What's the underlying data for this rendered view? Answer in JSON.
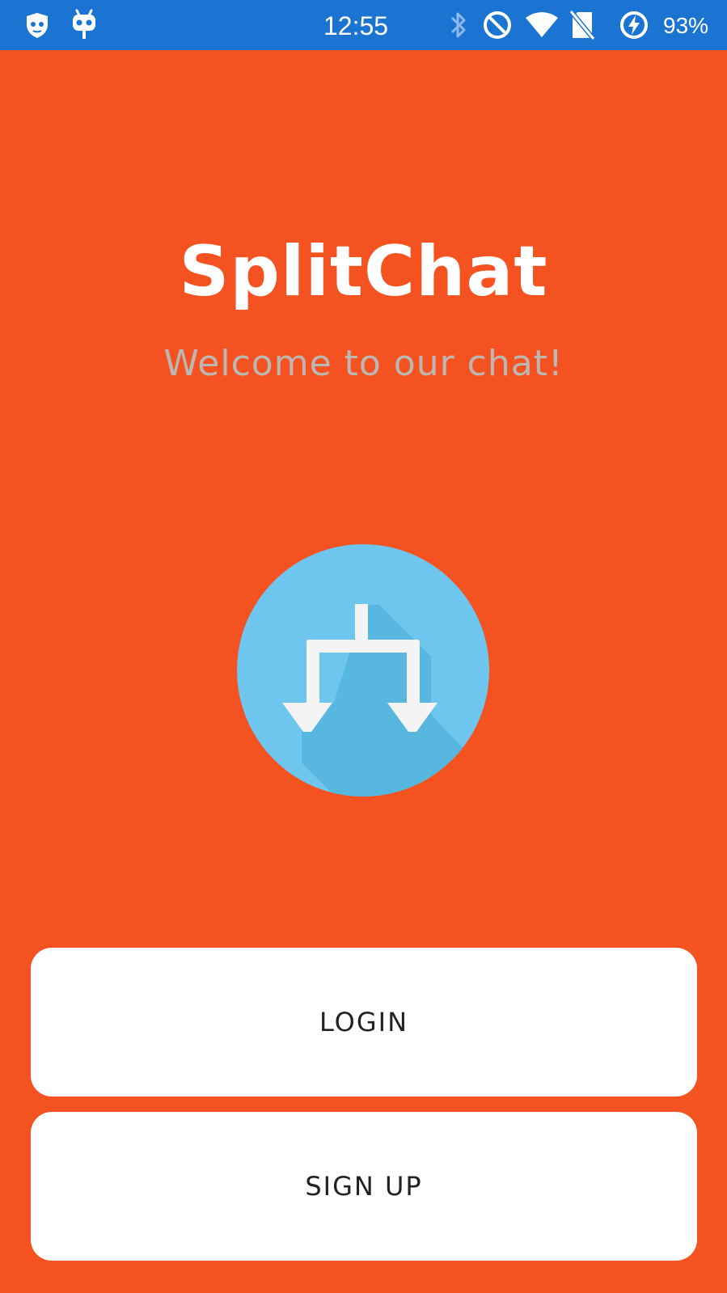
{
  "status_bar": {
    "time": "12:55",
    "battery_percent": "93%",
    "icons": [
      "shield-cat-icon",
      "android-robot-icon",
      "bluetooth-icon",
      "do-not-disturb-icon",
      "wifi-icon",
      "no-sim-icon",
      "battery-charging-icon"
    ],
    "background_color": "#1C74D2"
  },
  "app": {
    "title": "SplitChat",
    "subtitle": "Welcome to our chat!",
    "background_color": "#F55221",
    "logo_icon": "split-arrows-icon",
    "logo_color": "#6EC6EE"
  },
  "actions": {
    "login_label": "LOGIN",
    "signup_label": "SIGN UP"
  }
}
